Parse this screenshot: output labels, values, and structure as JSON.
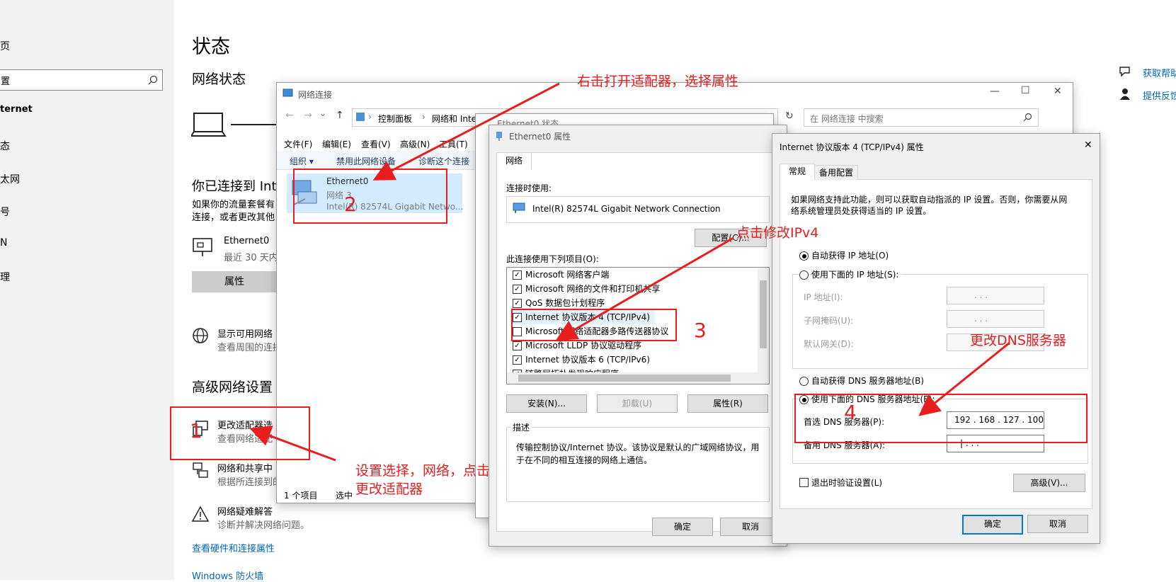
{
  "sidebar": {
    "items": [
      "页",
      "ternet",
      "态",
      "太网",
      "号",
      "N",
      "理"
    ],
    "search_placeholder": "置"
  },
  "settings": {
    "title": "状态",
    "network_status": "网络状态",
    "connected_heading": "你已连接到 Inte",
    "connected_desc1": "如果你的流量套餐有",
    "connected_desc2": "连接，或者更改其他",
    "adapter_name": "Ethernet0",
    "adapter_sub": "最近 30 天内",
    "properties_button": "属性",
    "show_networks_title": "显示可用网络",
    "show_networks_desc": "查看周围的连接",
    "advanced_heading": "高级网络设置",
    "change_adapter_title": "更改适配器选",
    "change_adapter_desc": "查看网络适配",
    "sharing_title": "网络和共享中",
    "sharing_desc": "根据所连接到的",
    "troubleshoot_title": "网络疑难解答",
    "troubleshoot_desc": "诊断并解决网络问题。",
    "hardware_link": "查看硬件和连接属性",
    "firewall_link": "Windows 防火墙",
    "help_link": "获取帮助",
    "feedback_link": "提供反馈"
  },
  "net_conn": {
    "title": "网络连接",
    "minimize": "—",
    "maximize": "☐",
    "close": "✕",
    "back": "←",
    "forward": "→",
    "dropdown_arrow": "⌄",
    "up": "↑",
    "crumb1": "控制面板",
    "crumb_sep": "›",
    "crumb2": "网络和 Inte",
    "refresh": "↻",
    "search_placeholder": "在 网络连接 中搜索",
    "menu": [
      "文件(F)",
      "编辑(E)",
      "查看(V)",
      "高级(N)",
      "工具(T)"
    ],
    "toolbar": [
      "组织 ▾",
      "禁用此网络设备",
      "诊断这个连接"
    ],
    "adapter_name": "Ethernet0",
    "adapter_net": "网络 3",
    "adapter_desc": "Intel(R) 82574L Gigabit Netwo...",
    "status_count": "1 个项目",
    "status_sel": "选中"
  },
  "eth_status": {
    "title": "Ethernet0 状态"
  },
  "eth_props": {
    "title": "Ethernet0 属性",
    "tab_network": "网络",
    "connect_using": "连接时使用:",
    "adapter": "Intel(R) 82574L Gigabit Network Connection",
    "configure_button": "配置(C)...",
    "items_label": "此连接使用下列项目(O):",
    "items": [
      {
        "label": "Microsoft 网络客户端",
        "checked": true
      },
      {
        "label": "Microsoft 网络的文件和打印机共享",
        "checked": true
      },
      {
        "label": "QoS 数据包计划程序",
        "checked": true
      },
      {
        "label": "Internet 协议版本 4 (TCP/IPv4)",
        "checked": true
      },
      {
        "label": "Microsoft 网络适配器多路传送器协议",
        "checked": false
      },
      {
        "label": "Microsoft LLDP 协议驱动程序",
        "checked": true
      },
      {
        "label": "Internet 协议版本 6 (TCP/IPv6)",
        "checked": true
      },
      {
        "label": "链路层拓扑发现响应程序",
        "checked": true
      }
    ],
    "install_button": "安装(N)...",
    "uninstall_button": "卸载(U)",
    "properties_button": "属性(R)",
    "desc_label": "描述",
    "desc_text1": "传输控制协议/Internet 协议。该协议是默认的广域网络协议，用",
    "desc_text2": "于在不同的相互连接的网络上通信。",
    "ok_button": "确定",
    "cancel_button": "取消"
  },
  "ipv4": {
    "title": "Internet 协议版本 4 (TCP/IPv4) 属性",
    "close": "✕",
    "tab_general": "常规",
    "tab_alternate": "备用配置",
    "intro1": "如果网络支持此功能，则可以获取自动指派的 IP 设置。否则，你需要从网",
    "intro2": "络系统管理员处获得适当的 IP 设置。",
    "auto_ip": "自动获得 IP 地址(O)",
    "manual_ip": "使用下面的 IP 地址(S):",
    "ip_label": "IP 地址(I):",
    "mask_label": "子网掩码(U):",
    "gateway_label": "默认网关(D):",
    "empty_ip": ".      .      .",
    "auto_dns": "自动获得 DNS 服务器地址(B)",
    "manual_dns": "使用下面的 DNS 服务器地址(E):",
    "pref_dns_label": "首选 DNS 服务器(P):",
    "pref_dns_value": "192 . 168 . 127 . 100",
    "alt_dns_label": "备用 DNS 服务器(A):",
    "alt_dns_value": "|      .      .      .",
    "validate_label": "退出时验证设置(L)",
    "advanced_button": "高级(V)...",
    "ok_button": "确定",
    "cancel_button": "取消"
  },
  "annotations": {
    "a1_text": "右击打开适配器，选择属性",
    "a2_text": "点击修改IPv4",
    "a3_text": "更改DNS服务器",
    "a4_text1": "设置选择，网络，点击",
    "a4_text2": "更改适配器",
    "n1": "1",
    "n2": "2",
    "n3": "3",
    "n4": "4",
    "color": "#e81e1e"
  }
}
